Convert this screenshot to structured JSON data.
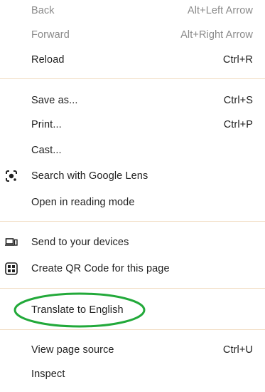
{
  "menu": {
    "back": {
      "label": "Back",
      "shortcut": "Alt+Left Arrow"
    },
    "forward": {
      "label": "Forward",
      "shortcut": "Alt+Right Arrow"
    },
    "reload": {
      "label": "Reload",
      "shortcut": "Ctrl+R"
    },
    "save_as": {
      "label": "Save as...",
      "shortcut": "Ctrl+S"
    },
    "print": {
      "label": "Print...",
      "shortcut": "Ctrl+P"
    },
    "cast": {
      "label": "Cast..."
    },
    "google_lens": {
      "label": "Search with Google Lens",
      "icon": "google-lens-icon"
    },
    "reading_mode": {
      "label": "Open in reading mode"
    },
    "send_devices": {
      "label": "Send to your devices",
      "icon": "devices-icon"
    },
    "qr_code": {
      "label": "Create QR Code for this page",
      "icon": "qr-code-icon"
    },
    "translate": {
      "label": "Translate to English"
    },
    "view_source": {
      "label": "View page source",
      "shortcut": "Ctrl+U"
    },
    "inspect": {
      "label": "Inspect"
    }
  },
  "annotation": {
    "color": "#22a93a"
  },
  "colors": {
    "separator": "#f1dcc2",
    "disabled_text": "#8a8a8a",
    "text": "#1f1f1f"
  }
}
